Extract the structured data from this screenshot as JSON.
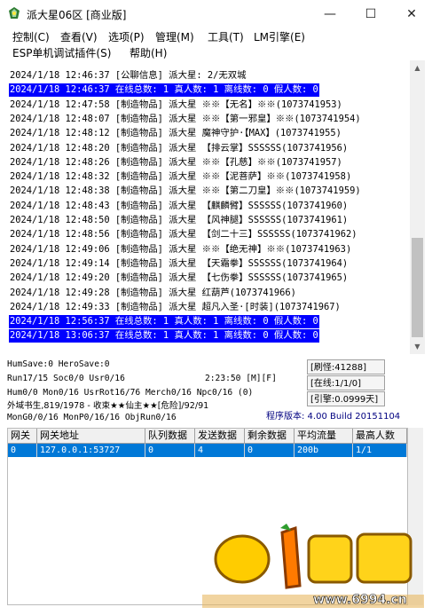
{
  "window": {
    "title": "派大星06区 [商业版]"
  },
  "titlebar_buttons": {
    "minimize": "—",
    "maximize": "☐",
    "close": "✕"
  },
  "menu": [
    {
      "label": "控制(C)"
    },
    {
      "label": "查看(V)"
    },
    {
      "label": "选项(P)"
    },
    {
      "label": "管理(M)"
    },
    {
      "label": "工具(T)"
    },
    {
      "label": "LM引擎(E)"
    },
    {
      "label": "ESP单机调试插件(S)"
    },
    {
      "label": "帮助(H)"
    }
  ],
  "log": [
    {
      "text": "2024/1/18 12:46:37 [公聊信息] 派大星: 2/无双城",
      "hl": false
    },
    {
      "text": "2024/1/18 12:46:37 在线总数: 1 真人数: 1 离线数: 0 假人数: 0",
      "hl": true
    },
    {
      "text": "2024/1/18 12:47:58 [制造物品] 派大星 ※※【无名】※※(1073741953)",
      "hl": false
    },
    {
      "text": "2024/1/18 12:48:07 [制造物品] 派大星 ※※【第一邪皇】※※(1073741954)",
      "hl": false
    },
    {
      "text": "2024/1/18 12:48:12 [制造物品] 派大星 魔神守护·【MAX】(1073741955)",
      "hl": false
    },
    {
      "text": "2024/1/18 12:48:20 [制造物品] 派大星 【排云掌】SSSSSS(1073741956)",
      "hl": false
    },
    {
      "text": "2024/1/18 12:48:26 [制造物品] 派大星 ※※【孔慈】※※(1073741957)",
      "hl": false
    },
    {
      "text": "2024/1/18 12:48:32 [制造物品] 派大星 ※※【泥菩萨】※※(1073741958)",
      "hl": false
    },
    {
      "text": "2024/1/18 12:48:38 [制造物品] 派大星 ※※【第二刀皇】※※(1073741959)",
      "hl": false
    },
    {
      "text": "2024/1/18 12:48:43 [制造物品] 派大星 【麒麟臂】SSSSSS(1073741960)",
      "hl": false
    },
    {
      "text": "2024/1/18 12:48:50 [制造物品] 派大星 【风神腿】SSSSSS(1073741961)",
      "hl": false
    },
    {
      "text": "2024/1/18 12:48:56 [制造物品] 派大星 【剑二十三】SSSSSS(1073741962)",
      "hl": false
    },
    {
      "text": "2024/1/18 12:49:06 [制造物品] 派大星 ※※【绝无神】※※(1073741963)",
      "hl": false
    },
    {
      "text": "2024/1/18 12:49:14 [制造物品] 派大星 【天霜拳】SSSSSS(1073741964)",
      "hl": false
    },
    {
      "text": "2024/1/18 12:49:20 [制造物品] 派大星 【七伤拳】SSSSSS(1073741965)",
      "hl": false
    },
    {
      "text": "2024/1/18 12:49:28 [制造物品] 派大星 红葫芦(1073741966)",
      "hl": false
    },
    {
      "text": "2024/1/18 12:49:33 [制造物品] 派大星 超凡入圣·[时装](1073741967)",
      "hl": false
    },
    {
      "text": "2024/1/18 12:56:37 在线总数: 1 真人数: 1 离线数: 0 假人数: 0",
      "hl": true
    },
    {
      "text": "2024/1/18 13:06:37 在线总数: 1 真人数: 1 离线数: 0 假人数: 0",
      "hl": true
    }
  ],
  "status": {
    "line1": "HumSave:0 HeroSave:0",
    "line2": "Run17/15 Soc0/0 Usr0/16",
    "line2_time": "2:23:50 [M][F]",
    "line3": "Hum0/0 Mon0/16 UsrRot16/76 Merch0/16 Npc0/16 (0)",
    "line4": "外域书生,819/1978 - 收束★★仙主★★[危险]/92/91",
    "line5": "MonG0/0/16 MonP0/16/16 ObjRun0/16"
  },
  "right_panel": {
    "refresh": "[刷怪:41288]",
    "online": "[在线:1/1/0]",
    "engine": "[引擎:0.0999天]",
    "version": "程序版本: 4.00 Build 20151104"
  },
  "gateway_table": {
    "headers": [
      "网关",
      "网关地址",
      "队列数据",
      "发送数据",
      "剩余数据",
      "平均流量",
      "最高人数"
    ],
    "rows": [
      [
        "0",
        "127.0.0.1:53727",
        "0",
        "4",
        "0",
        "200b",
        "1/1"
      ]
    ]
  },
  "watermark": {
    "text": "萝卜论坛",
    "url": "www.6994.cn"
  },
  "colors": {
    "highlight": "#0000ff",
    "selected_row": "#0078d7",
    "version_text": "#000080"
  }
}
